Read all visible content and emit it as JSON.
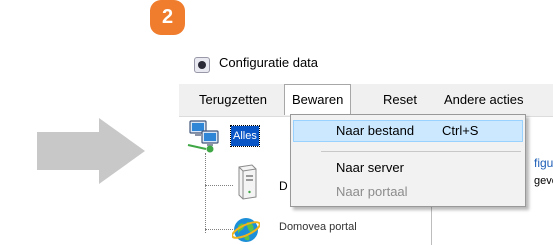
{
  "step_badge": "2",
  "window": {
    "title": "Configuratie data",
    "colors": {
      "selection": "#0a56c7",
      "menu_highlight": "#cce8ff",
      "badge": "#ef7d2d",
      "arrow": "#c8c8c8"
    }
  },
  "menubar": {
    "items": [
      "Terugzetten",
      "Bewaren",
      "Reset",
      "Andere acties"
    ]
  },
  "dropdown": {
    "items": [
      {
        "label": "Naar bestand",
        "shortcut": "Ctrl+S",
        "highlighted": true,
        "enabled": true
      },
      {
        "label": "Naar server",
        "shortcut": "",
        "highlighted": false,
        "enabled": true
      },
      {
        "label": "Naar portaal",
        "shortcut": "",
        "highlighted": false,
        "enabled": false
      }
    ]
  },
  "tree": {
    "root_label": "Alles",
    "child_server_label": "D",
    "child_portal_label": "Domovea portal",
    "icons": [
      "network-computers-icon",
      "server-tower-icon",
      "globe-icon"
    ]
  },
  "right_panel": {
    "partial_text_1": "figu",
    "partial_text_2": "geve"
  }
}
